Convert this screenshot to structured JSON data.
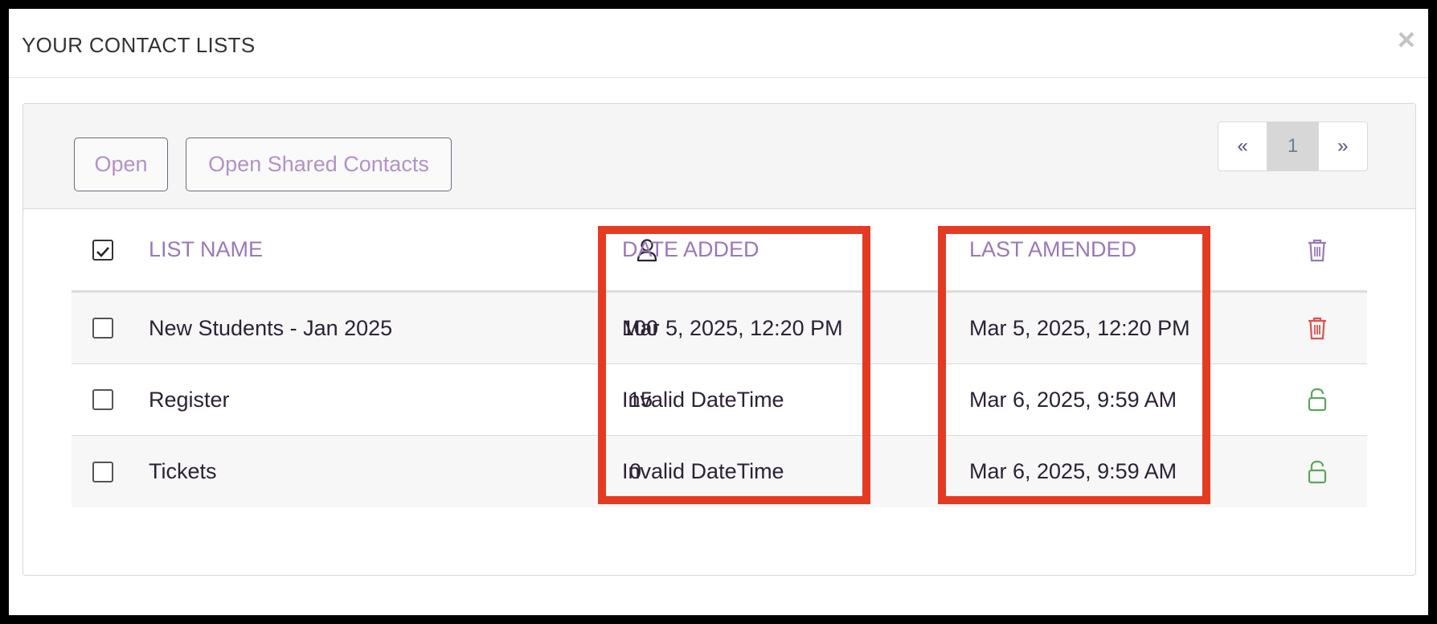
{
  "modal": {
    "title": "YOUR CONTACT LISTS",
    "close_label": "×"
  },
  "toolbar": {
    "open_label": "Open",
    "open_shared_label": "Open Shared Contacts"
  },
  "pagination": {
    "prev": "«",
    "current": "1",
    "next": "»"
  },
  "table": {
    "headers": {
      "list_name": "LIST NAME",
      "count_icon": "person-icon",
      "date_added": "DATE ADDED",
      "last_amended": "LAST AMENDED",
      "action_icon": "trash-icon"
    },
    "rows": [
      {
        "name": "New Students - Jan 2025",
        "count": "100",
        "date_added": "Mar 5, 2025, 12:20 PM",
        "last_amended": "Mar 5, 2025, 12:20 PM",
        "action_icon": "trash-icon",
        "action_color": "#d9534f"
      },
      {
        "name": "Register",
        "count": "15",
        "date_added": "Invalid DateTime",
        "last_amended": "Mar 6, 2025, 9:59 AM",
        "action_icon": "lock-icon",
        "action_color": "#5aa65a"
      },
      {
        "name": "Tickets",
        "count": "0",
        "date_added": "Invalid DateTime",
        "last_amended": "Mar 6, 2025, 9:59 AM",
        "action_icon": "lock-icon",
        "action_color": "#5aa65a"
      }
    ]
  },
  "colors": {
    "accent": "#9a78b8",
    "highlight": "#e53a22",
    "delete": "#d9534f",
    "locked": "#5aa65a"
  }
}
